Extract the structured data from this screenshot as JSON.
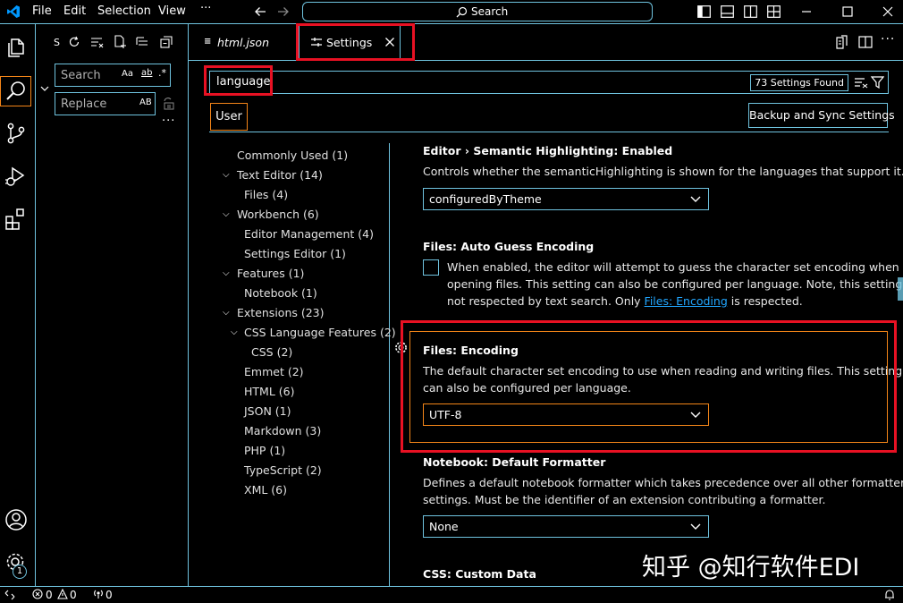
{
  "titlebar": {
    "menus": [
      "File",
      "Edit",
      "Selection",
      "View",
      "···"
    ],
    "search_label": "Search"
  },
  "sidebar": {
    "header_letter": "S",
    "search_placeholder": "Search",
    "search_opts": [
      "Aa",
      "ab",
      ".*"
    ],
    "replace_placeholder": "Replace",
    "replace_opt": "AB"
  },
  "tabs": [
    {
      "label": "html.json"
    },
    {
      "label": "Settings",
      "active": true
    }
  ],
  "settings": {
    "search_value": "language",
    "found_badge": "73 Settings Found",
    "scope_tab": "User",
    "backup_button": "Backup and Sync Settings",
    "toc": [
      {
        "label": "Commonly Used (1)"
      },
      {
        "label": "Text Editor (14)"
      },
      {
        "label": "Files (4)"
      },
      {
        "label": "Workbench (6)"
      },
      {
        "label": "Editor Management (4)"
      },
      {
        "label": "Settings Editor (1)"
      },
      {
        "label": "Features (1)"
      },
      {
        "label": "Notebook (1)"
      },
      {
        "label": "Extensions (23)"
      },
      {
        "label": "CSS Language Features (2)"
      },
      {
        "label": "CSS (2)"
      },
      {
        "label": "Emmet (2)"
      },
      {
        "label": "HTML (6)"
      },
      {
        "label": "JSON (1)"
      },
      {
        "label": "Markdown (3)"
      },
      {
        "label": "PHP (1)"
      },
      {
        "label": "TypeScript (2)"
      },
      {
        "label": "XML (6)"
      }
    ],
    "items": {
      "semantic": {
        "title": "Editor › Semantic Highlighting: Enabled",
        "desc": "Controls whether the semanticHighlighting is shown for the languages that support it.",
        "value": "configuredByTheme"
      },
      "autoguess": {
        "title": "Files: Auto Guess Encoding",
        "desc_line1": "When enabled, the editor will attempt to guess the character set encoding when",
        "desc_line2": "opening files. This setting can also be configured per language. Note, this setting is",
        "desc_line3_a": "not respected by text search. Only ",
        "desc_line3_link": "Files: Encoding",
        "desc_line3_b": " is respected."
      },
      "encoding": {
        "title": "Files: Encoding",
        "desc_line1": "The default character set encoding to use when reading and writing files. This setting",
        "desc_line2": "can also be configured per language.",
        "value": "UTF-8"
      },
      "formatter": {
        "title": "Notebook: Default Formatter",
        "desc_line1": "Defines a default notebook formatter which takes precedence over all other formatter",
        "desc_line2": "settings. Must be the identifier of an extension contributing a formatter.",
        "value": "None"
      },
      "cssdata": {
        "title": "CSS: Custom Data"
      }
    }
  },
  "statusbar": {
    "errors": "0",
    "warnings": "0",
    "ports": "0"
  },
  "activity": {
    "badge": "1"
  },
  "watermark": "知乎 @知行软件EDI",
  "colors": {
    "contrast_border": "#6fc3df",
    "focus_border": "#f38518",
    "annotation": "#e81123",
    "link": "#21a6ff",
    "vscode_blue": "#0098ff"
  }
}
